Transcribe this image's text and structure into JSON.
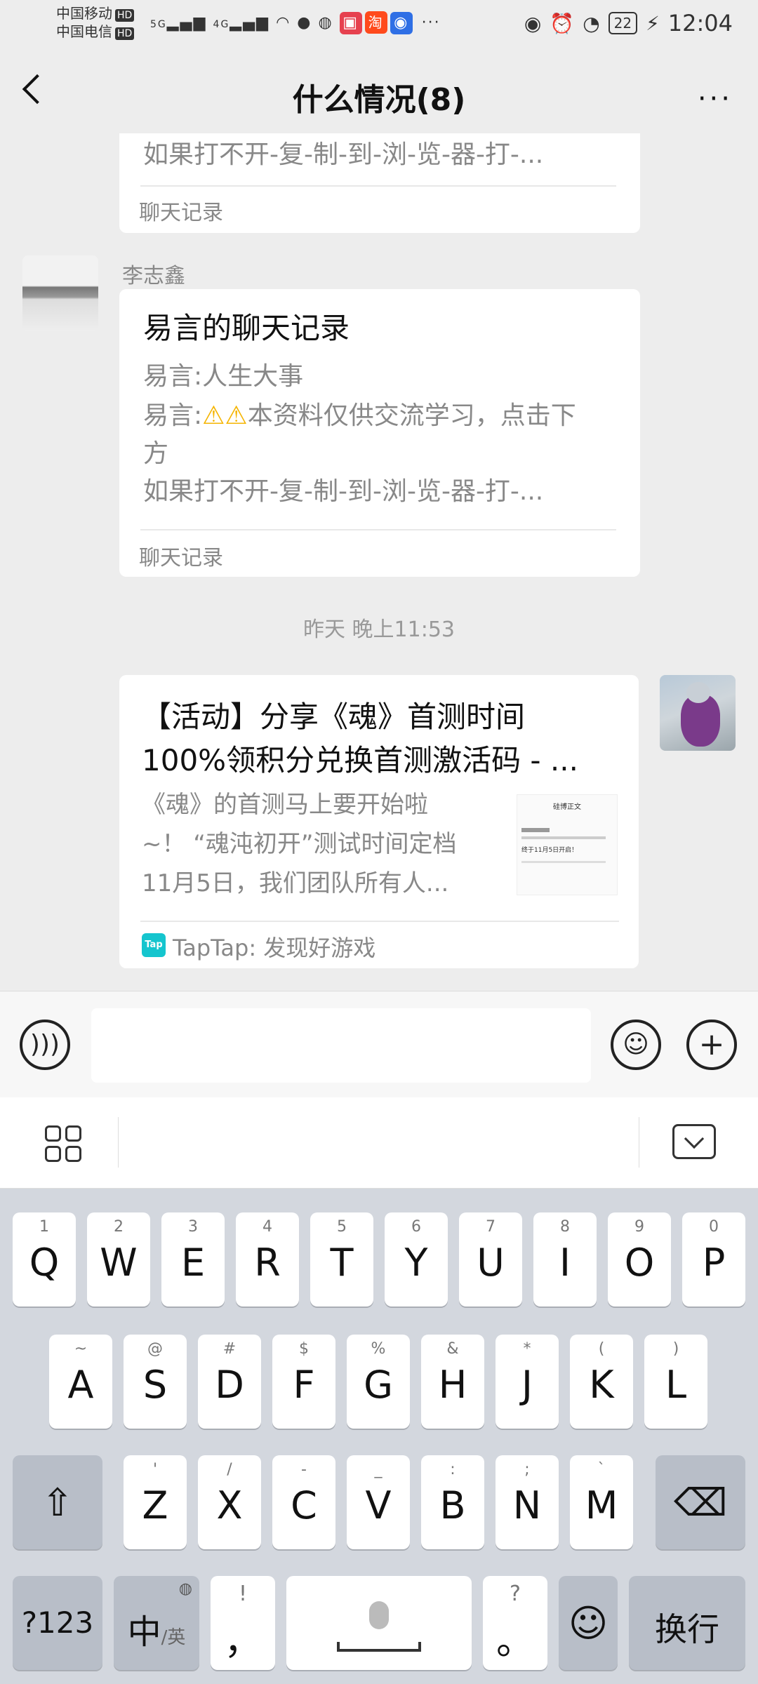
{
  "status_bar": {
    "carrier1": "中国移动",
    "carrier2": "中国电信",
    "hd": "HD",
    "net1": "5G",
    "net2": "4G",
    "battery": "22",
    "time": "12:04",
    "app_icons": [
      "book-app-icon",
      "taobao-app-icon",
      "bulb-app-icon"
    ],
    "app_badge_text": "淘",
    "more_dots": "···"
  },
  "nav": {
    "title": "什么情况(8)",
    "more": "···"
  },
  "messages": {
    "partial_card": {
      "line": "如果打不开-复-制-到-浏-览-器-打-...",
      "footer": "聊天记录"
    },
    "record_card": {
      "sender": "李志鑫",
      "title": "易言的聊天记录",
      "line1": "易言:人生大事",
      "line2_prefix": "易言:",
      "line2_rest": "本资料仅供交流学习，点击下",
      "line3": "方",
      "line4": "如果打不开-复-制-到-浏-览-器-打-...",
      "footer": "聊天记录"
    },
    "timestamp": "昨天 晚上11:53",
    "link_card": {
      "title_line1": "【活动】分享《魂》首测时间",
      "title_line2": "100%领积分兑换首测激活码 - ...",
      "desc_line1": "《魂》的首测马上要开始啦",
      "desc_line2": "~！ “魂沌初开”测试时间定档",
      "desc_line3": "11月5日，我们团队所有人...",
      "thumb_title": "硅博正文",
      "thumb_text": "终于11月5日开启！",
      "source_badge": "Tap",
      "source": "TapTap: 发现好游戏"
    }
  },
  "input_bar": {
    "placeholder": ""
  },
  "keyboard": {
    "row1": [
      {
        "hint": "1",
        "key": "Q"
      },
      {
        "hint": "2",
        "key": "W"
      },
      {
        "hint": "3",
        "key": "E"
      },
      {
        "hint": "4",
        "key": "R"
      },
      {
        "hint": "5",
        "key": "T"
      },
      {
        "hint": "6",
        "key": "Y"
      },
      {
        "hint": "7",
        "key": "U"
      },
      {
        "hint": "8",
        "key": "I"
      },
      {
        "hint": "9",
        "key": "O"
      },
      {
        "hint": "0",
        "key": "P"
      }
    ],
    "row2": [
      {
        "hint": "~",
        "key": "A"
      },
      {
        "hint": "@",
        "key": "S"
      },
      {
        "hint": "#",
        "key": "D"
      },
      {
        "hint": "$",
        "key": "F"
      },
      {
        "hint": "%",
        "key": "G"
      },
      {
        "hint": "&",
        "key": "H"
      },
      {
        "hint": "*",
        "key": "J"
      },
      {
        "hint": "(",
        "key": "K"
      },
      {
        "hint": ")",
        "key": "L"
      }
    ],
    "row3": [
      {
        "hint": "'",
        "key": "Z"
      },
      {
        "hint": "/",
        "key": "X"
      },
      {
        "hint": "-",
        "key": "C"
      },
      {
        "hint": "_",
        "key": "V"
      },
      {
        "hint": ":",
        "key": "B"
      },
      {
        "hint": ";",
        "key": "N"
      },
      {
        "hint": "`",
        "key": "M"
      }
    ],
    "num_key": "?123",
    "lang_key": "中",
    "lang_sub": "/英",
    "comma_hint": "!",
    "comma": "，",
    "period_hint": "?",
    "period": "。",
    "enter": "换行"
  }
}
